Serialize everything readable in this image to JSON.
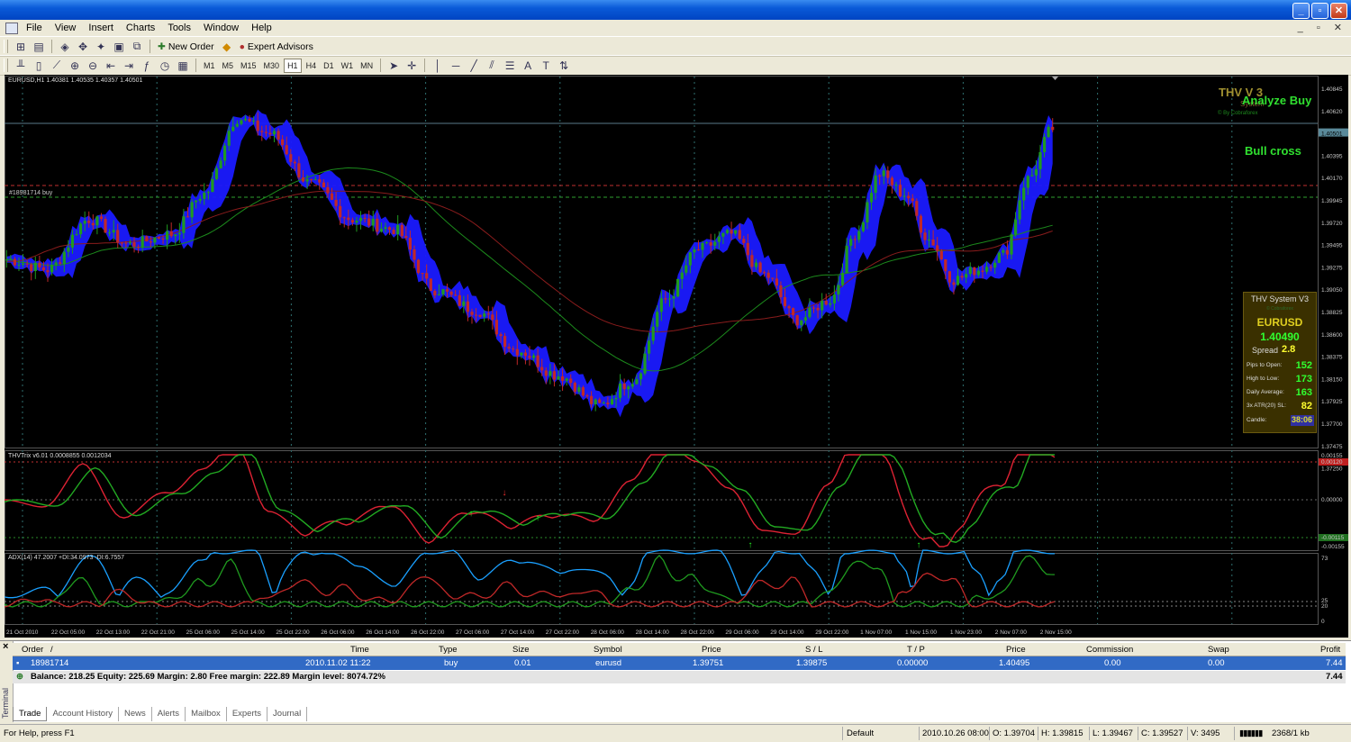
{
  "menu": [
    "File",
    "View",
    "Insert",
    "Charts",
    "Tools",
    "Window",
    "Help"
  ],
  "toolbar": {
    "new_order": "New Order",
    "expert_advisors": "Expert Advisors",
    "timeframes": [
      "M1",
      "M5",
      "M15",
      "M30",
      "H1",
      "H4",
      "D1",
      "W1",
      "MN"
    ],
    "active_timeframe": "H1"
  },
  "chart": {
    "header": "EURUSD,H1  1.40381 1.40535 1.40357 1.40501",
    "order_label": "#18981714 buy",
    "price_axis": [
      "1.40845",
      "1.40620",
      "1.40501",
      "1.40395",
      "1.40170",
      "1.39945",
      "1.39720",
      "1.39495",
      "1.39275",
      "1.39050",
      "1.38825",
      "1.38600",
      "1.38375",
      "1.38150",
      "1.37925",
      "1.37700",
      "1.37475",
      "1.37250"
    ],
    "time_axis": [
      "21 Oct 2010",
      "22 Oct 05:00",
      "22 Oct 13:00",
      "22 Oct 21:00",
      "25 Oct 06:00",
      "25 Oct 14:00",
      "25 Oct 22:00",
      "26 Oct 06:00",
      "26 Oct 14:00",
      "26 Oct 22:00",
      "27 Oct 06:00",
      "27 Oct 14:00",
      "27 Oct 22:00",
      "28 Oct 06:00",
      "28 Oct 14:00",
      "28 Oct 22:00",
      "29 Oct 06:00",
      "29 Oct 14:00",
      "29 Oct 22:00",
      "1 Nov 07:00",
      "1 Nov 15:00",
      "1 Nov 23:00",
      "2 Nov 07:00",
      "2 Nov 15:00"
    ],
    "osc_header": "THVTrix v6.01 0.0008855 0.0012034",
    "osc_axis": [
      "0.00155",
      "0.00120",
      "0.00000",
      "-0.00115",
      "-0.00155"
    ],
    "adx_header": "ADX(14) 47.2007 +DI:34.0973 -DI:6.7557",
    "adx_axis": [
      "73",
      "25",
      "20",
      "0"
    ],
    "colors": {
      "bull": "#1f9a1f",
      "bear": "#c02828",
      "cloud": "#1a1aff",
      "osc_green": "#22aa22",
      "osc_red": "#dd2233",
      "adx_blue": "#1aa0ff",
      "grid": "#2f6f6f"
    }
  },
  "overlay": {
    "brand_title": "THV V 3",
    "brand_sub": "System",
    "brand_credit": "© By Cobraforex",
    "analyze": "Analyze Buy",
    "bull_cross": "Bull cross"
  },
  "panel": {
    "title": "THV System V3",
    "credit": "© Cobraforex",
    "symbol": "EURUSD",
    "price": "1.40490",
    "spread_label": "Spread",
    "spread": "2.8",
    "pips_open_label": "Pips to Open:",
    "pips_open": "152",
    "high_low_label": "High to Low:",
    "high_low": "173",
    "daily_avg_label": "Daily Average:",
    "daily_avg": "163",
    "atr_label": "3x ATR(20) SL:",
    "atr": "82",
    "candle_label": "Candle:",
    "candle": "38:06"
  },
  "terminal": {
    "columns": [
      "Order",
      "/",
      "Time",
      "Type",
      "Size",
      "Symbol",
      "Price",
      "S / L",
      "T / P",
      "Price",
      "Commission",
      "Swap",
      "Profit"
    ],
    "row": {
      "order": "18981714",
      "time": "2010.11.02 11:22",
      "type": "buy",
      "size": "0.01",
      "symbol": "eurusd",
      "price": "1.39751",
      "sl": "1.39875",
      "tp": "0.00000",
      "cur_price": "1.40495",
      "commission": "0.00",
      "swap": "0.00",
      "profit": "7.44"
    },
    "balance": "Balance: 218.25  Equity: 225.69  Margin: 2.80  Free margin: 222.89  Margin level: 8074.72%",
    "balance_profit": "7.44",
    "tabs": [
      "Trade",
      "Account History",
      "News",
      "Alerts",
      "Mailbox",
      "Experts",
      "Journal"
    ],
    "side_label": "Terminal"
  },
  "status": {
    "help": "For Help, press F1",
    "profile": "Default",
    "time": "2010.10.26 08:00",
    "open": "O: 1.39704",
    "high": "H: 1.39815",
    "low": "L: 1.39467",
    "close": "C: 1.39527",
    "volume": "V: 3495",
    "traffic": "2368/1 kb"
  }
}
